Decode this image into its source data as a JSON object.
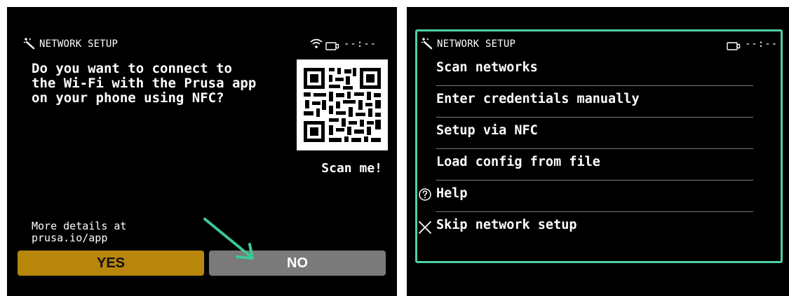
{
  "left_screen": {
    "header": {
      "title": "NETWORK SETUP",
      "time": "--:--",
      "icons": [
        "wizard-icon",
        "wifi-icon",
        "usb-drive-icon"
      ]
    },
    "question": "Do you want to connect to\nthe Wi-Fi with the Prusa app\non your phone using NFC?",
    "qr": {
      "label": "Scan me!"
    },
    "more_details": "More details at\nprusa.io/app",
    "buttons": {
      "yes_label": "YES",
      "no_label": "NO"
    },
    "colors": {
      "yes": "#b8860b",
      "no": "#7a7a7a"
    }
  },
  "right_screen": {
    "header": {
      "title": "NETWORK SETUP",
      "time": "--:--",
      "icons": [
        "wizard-icon",
        "usb-drive-icon"
      ]
    },
    "menu": [
      {
        "label": "Scan networks",
        "icon": ""
      },
      {
        "label": "Enter credentials manually",
        "icon": ""
      },
      {
        "label": "Setup via NFC",
        "icon": ""
      },
      {
        "label": "Load config from file",
        "icon": ""
      },
      {
        "label": "Help",
        "icon": "help-icon"
      },
      {
        "label": "Skip network setup",
        "icon": "close-icon"
      }
    ],
    "colors": {
      "highlight": "#4fd0a0"
    }
  },
  "annotation": {
    "arrow_color": "#3ec894"
  }
}
